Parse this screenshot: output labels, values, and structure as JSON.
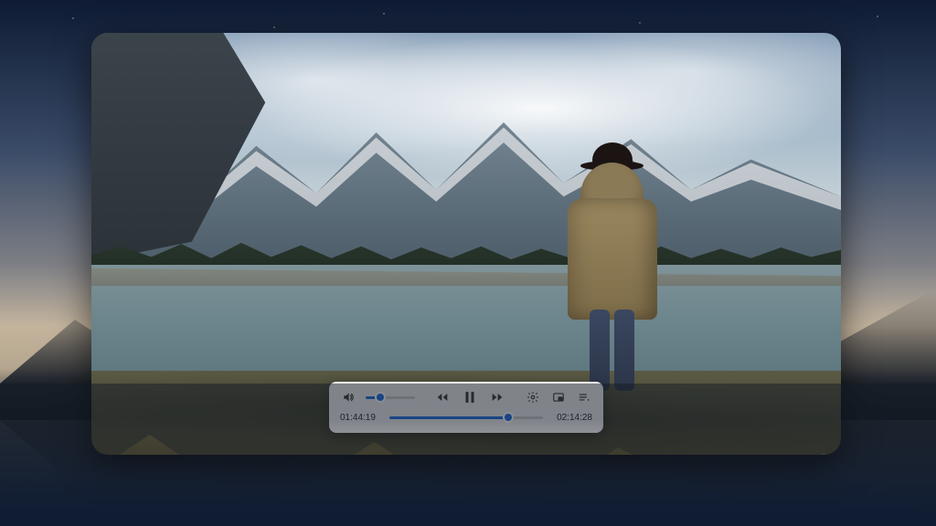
{
  "player": {
    "current_time": "01:44:19",
    "total_time": "02:14:28",
    "progress_percent": 77.6,
    "volume_percent": 30,
    "state": "playing",
    "icons": {
      "volume": "volume-icon",
      "rewind": "rewind-icon",
      "pause": "pause-icon",
      "forward": "forward-icon",
      "settings": "settings-icon",
      "pip": "pip-icon",
      "playlist": "playlist-icon"
    },
    "colors": {
      "accent": "#1f6fe5",
      "panel_bg": "rgba(244,244,246,0.96)",
      "icon": "#3b3b3d",
      "rail": "#c9c9cc"
    }
  }
}
